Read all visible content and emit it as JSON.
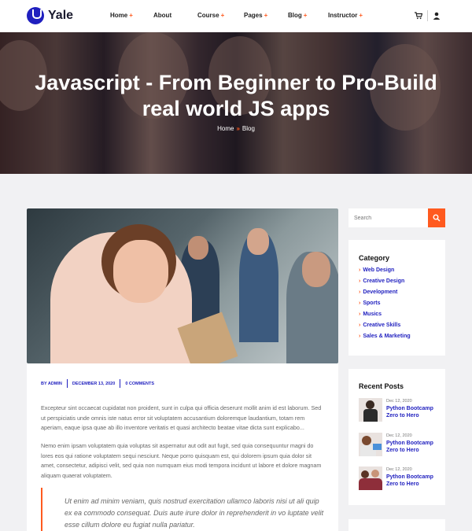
{
  "header": {
    "logo_text": "Yale",
    "nav": [
      {
        "label": "Home",
        "plus": "+"
      },
      {
        "label": "About",
        "plus": ""
      },
      {
        "label": "Course",
        "plus": "+"
      },
      {
        "label": "Pages",
        "plus": "+"
      },
      {
        "label": "Blog",
        "plus": "+"
      },
      {
        "label": "Instructor",
        "plus": "+"
      }
    ],
    "icons": [
      "cart-icon",
      "user-icon"
    ]
  },
  "hero": {
    "title": "Javascript - From Beginner to Pro-Build real world JS apps",
    "breadcrumb_home": "Home",
    "breadcrumb_sep": "»",
    "breadcrumb_current": "Blog"
  },
  "article": {
    "meta_author": "BY ADMIN",
    "meta_date": "DECEMBER 13, 2020",
    "meta_comments": "0 COMMENTS",
    "paragraph_1": "Excepteur sint occaecat cupidatat non proident, sunt in culpa qui officia deserunt mollit anim id est laborum. Sed ut perspiciatis unde omnis iste natus error sit voluptatem accusantium doloremque laudantium, totam rem aperiam, eaque ipsa quae ab illo inventore veritatis et quasi architecto beatae vitae dicta sunt explicabo...",
    "paragraph_2": "Nemo enim ipsam voluptatem quia voluptas sit aspernatur aut odit aut fugit, sed quia consequuntur magni do lores eos qui ratione voluptatem sequi nesciunt. Neque porro quisquam est, qui dolorem ipsum quia dolor sit amet, consectetur, adipisci velit, sed quia non numquam eius modi tempora incidunt ut labore et dolore magnam aliquam quaerat voluptatem.",
    "quote": "Ut enim ad minim veniam, quis nostrud exercitation ullamco laboris nisi ut ali quip ex ea commodo consequat. Duis aute irure dolor in reprehenderit in vo luptate velit esse cillum dolore eu fugiat nulla pariatur."
  },
  "sidebar": {
    "search_placeholder": "Search",
    "category_title": "Category",
    "categories": [
      "Web Design",
      "Creative Design",
      "Development",
      "Sports",
      "Musics",
      "Creative Skills",
      "Sales & Marketing"
    ],
    "recent_title": "Recent Posts",
    "recent_posts": [
      {
        "date": "Dec 12, 2020",
        "title": "Python Bootcamp Zero to Hero"
      },
      {
        "date": "Dec 12, 2020",
        "title": "Python Bootcamp Zero to Hero"
      },
      {
        "date": "Dec 12, 2020",
        "title": "Python Bootcamp Zero to Hero"
      }
    ]
  },
  "colors": {
    "accent": "#ff5a1f",
    "brand": "#1f1fbf"
  }
}
